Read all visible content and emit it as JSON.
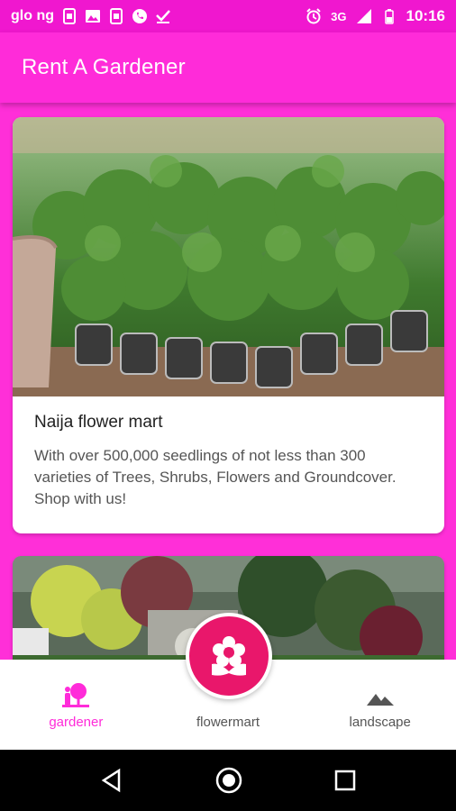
{
  "status_bar": {
    "carrier": "glo ng",
    "network": "3G",
    "time": "10:16",
    "left_icons": [
      "phone-card-icon",
      "image-icon",
      "phone-card-icon",
      "whatsapp-icon",
      "check-icon"
    ],
    "right_icons": [
      "alarm-icon",
      "signal-icon",
      "battery-icon"
    ]
  },
  "app_bar": {
    "title": "Rent A Gardener"
  },
  "cards": [
    {
      "title": "Naija flower mart",
      "description": "With over 500,000 seedlings of not less than 300 varieties of Trees, Shrubs, Flowers and Groundcover. Shop with us!",
      "image": "potted-seedlings-photo"
    },
    {
      "image": "landscaped-garden-photo"
    }
  ],
  "bottom_nav": {
    "items": [
      {
        "label": "gardener",
        "icon": "gardener-icon",
        "active": true
      },
      {
        "label": "flowermart",
        "icon": "flower-icon",
        "active": false
      },
      {
        "label": "landscape",
        "icon": "landscape-icon",
        "active": false
      }
    ]
  },
  "colors": {
    "primary": "#ff2bd9",
    "status_bar": "#f017cf",
    "fab": "#e9176b",
    "active_nav": "#ff2bd9"
  }
}
